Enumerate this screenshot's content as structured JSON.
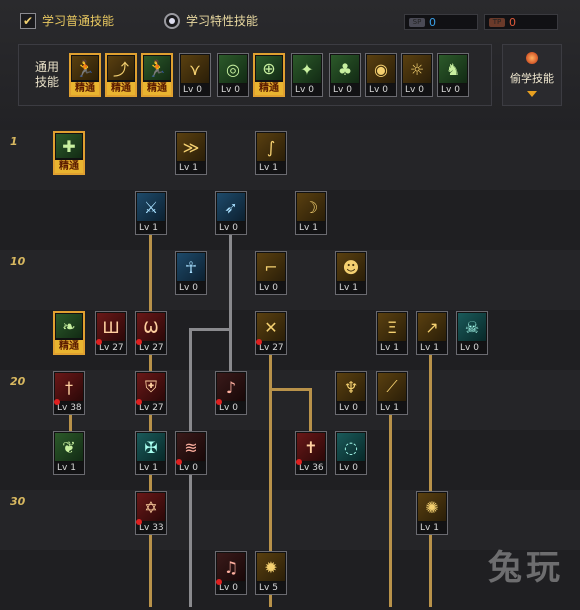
{
  "header": {
    "option_normal": "学习普通技能",
    "option_trait": "学习特性技能",
    "points_blue": {
      "icon": "SP",
      "value": "0"
    },
    "points_red": {
      "icon": "TP",
      "value": "0"
    }
  },
  "common": {
    "label_line1": "通用",
    "label_line2": "技能",
    "skills": [
      {
        "icon": "runner-icon",
        "glyph": "🏃",
        "tone": "gold",
        "level": "精通",
        "master": true
      },
      {
        "icon": "dash-icon",
        "glyph": "⤴",
        "tone": "gold",
        "level": "精通",
        "master": true
      },
      {
        "icon": "sprint-icon",
        "glyph": "🏃",
        "tone": "green",
        "level": "精通",
        "master": true
      },
      {
        "icon": "wings-icon",
        "glyph": "⋎",
        "tone": "gold",
        "level": "Lv 0",
        "master": false
      },
      {
        "icon": "target-icon",
        "glyph": "◎",
        "tone": "green",
        "level": "Lv 0",
        "master": false
      },
      {
        "icon": "crosshair-icon",
        "glyph": "⊕",
        "tone": "green",
        "level": "精通",
        "master": true
      },
      {
        "icon": "buff-icon",
        "glyph": "✦",
        "tone": "green",
        "level": "Lv 0",
        "master": false
      },
      {
        "icon": "mushroom-icon",
        "glyph": "♣",
        "tone": "green",
        "level": "Lv 0",
        "master": false
      },
      {
        "icon": "eye-icon",
        "glyph": "◉",
        "tone": "gold",
        "level": "Lv 0",
        "master": false
      },
      {
        "icon": "strength-icon",
        "glyph": "☼",
        "tone": "gold",
        "level": "Lv 0",
        "master": false
      },
      {
        "icon": "figure-icon",
        "glyph": "♞",
        "tone": "green",
        "level": "Lv 0",
        "master": false
      }
    ]
  },
  "steal_button": {
    "label": "偷学技能"
  },
  "tree": {
    "level_marks": [
      "1",
      "10",
      "20",
      "30"
    ],
    "skills": [
      {
        "name": "r1-green-cross",
        "glyph": "✚",
        "tone": "green",
        "level": "精通",
        "master": true,
        "up": false
      },
      {
        "name": "r1-kick",
        "glyph": "≫",
        "tone": "gold",
        "level": "Lv 1",
        "master": false,
        "up": false
      },
      {
        "name": "r1-claw",
        "glyph": "∫",
        "tone": "gold",
        "level": "Lv 1",
        "master": false,
        "up": false
      },
      {
        "name": "r2-sword",
        "glyph": "⚔",
        "tone": "blue",
        "level": "Lv 1",
        "master": false,
        "up": false
      },
      {
        "name": "r2-dash",
        "glyph": "➶",
        "tone": "blue",
        "level": "Lv 0",
        "master": false,
        "up": false
      },
      {
        "name": "r2-slash",
        "glyph": "☽",
        "tone": "gold",
        "level": "Lv 1",
        "master": false,
        "up": false
      },
      {
        "name": "r3-ankh",
        "glyph": "☥",
        "tone": "blue",
        "level": "Lv 0",
        "master": false,
        "up": false
      },
      {
        "name": "r3-boot",
        "glyph": "⌐",
        "tone": "gold",
        "level": "Lv 0",
        "master": false,
        "up": false
      },
      {
        "name": "r3-mask",
        "glyph": "☻",
        "tone": "gold",
        "level": "Lv 1",
        "master": false,
        "up": false
      },
      {
        "name": "r4-leaf",
        "glyph": "❧",
        "tone": "green",
        "level": "精通",
        "master": true,
        "up": false
      },
      {
        "name": "r4-claws",
        "glyph": "Ш",
        "tone": "red",
        "level": "Lv 27",
        "master": false,
        "up": true
      },
      {
        "name": "r4-wings",
        "glyph": "Ѡ",
        "tone": "red",
        "level": "Lv 27",
        "master": false,
        "up": true
      },
      {
        "name": "r4-crossed-swords",
        "glyph": "✕",
        "tone": "gold",
        "level": "Lv 27",
        "master": false,
        "up": true
      },
      {
        "name": "r4-gate",
        "glyph": "Ξ",
        "tone": "gold",
        "level": "Lv 1",
        "master": false,
        "up": false
      },
      {
        "name": "r4-runner",
        "glyph": "↗",
        "tone": "gold",
        "level": "Lv 1",
        "master": false,
        "up": false
      },
      {
        "name": "r4-spirit",
        "glyph": "☠",
        "tone": "teal",
        "level": "Lv 0",
        "master": false,
        "up": false
      },
      {
        "name": "r5-blade",
        "glyph": "†",
        "tone": "red",
        "level": "Lv 38",
        "master": false,
        "up": true
      },
      {
        "name": "r5-shield",
        "glyph": "⛨",
        "tone": "red",
        "level": "Lv 27",
        "master": false,
        "up": true
      },
      {
        "name": "r5-note",
        "glyph": "♪",
        "tone": "darkred",
        "level": "Lv 0",
        "master": false,
        "up": true
      },
      {
        "name": "r5-horn",
        "glyph": "♆",
        "tone": "gold",
        "level": "Lv 0",
        "master": false,
        "up": false
      },
      {
        "name": "r5-spear",
        "glyph": "⟋",
        "tone": "gold",
        "level": "Lv 1",
        "master": false,
        "up": false
      },
      {
        "name": "r6-leaf",
        "glyph": "❦",
        "tone": "green",
        "level": "Lv 1",
        "master": false,
        "up": false
      },
      {
        "name": "r6-shield-cross",
        "glyph": "✠",
        "tone": "teal",
        "level": "Lv 1",
        "master": false,
        "up": false
      },
      {
        "name": "r6-fire-slash",
        "glyph": "≋",
        "tone": "darkred",
        "level": "Lv 0",
        "master": false,
        "up": true
      },
      {
        "name": "r6-holy-cross",
        "glyph": "✝",
        "tone": "red",
        "level": "Lv 36",
        "master": false,
        "up": true
      },
      {
        "name": "r6-vortex",
        "glyph": "◌",
        "tone": "teal",
        "level": "Lv 0",
        "master": false,
        "up": false
      },
      {
        "name": "r7-star",
        "glyph": "✡",
        "tone": "red",
        "level": "Lv 33",
        "master": false,
        "up": true
      },
      {
        "name": "r7-burst",
        "glyph": "✺",
        "tone": "gold",
        "level": "Lv 1",
        "master": false,
        "up": false
      },
      {
        "name": "r8-music",
        "glyph": "♫",
        "tone": "darkred",
        "level": "Lv 0",
        "master": false,
        "up": true
      },
      {
        "name": "r8-sun",
        "glyph": "✹",
        "tone": "gold",
        "level": "Lv 5",
        "master": false,
        "up": false
      }
    ]
  },
  "watermark": "兔玩"
}
